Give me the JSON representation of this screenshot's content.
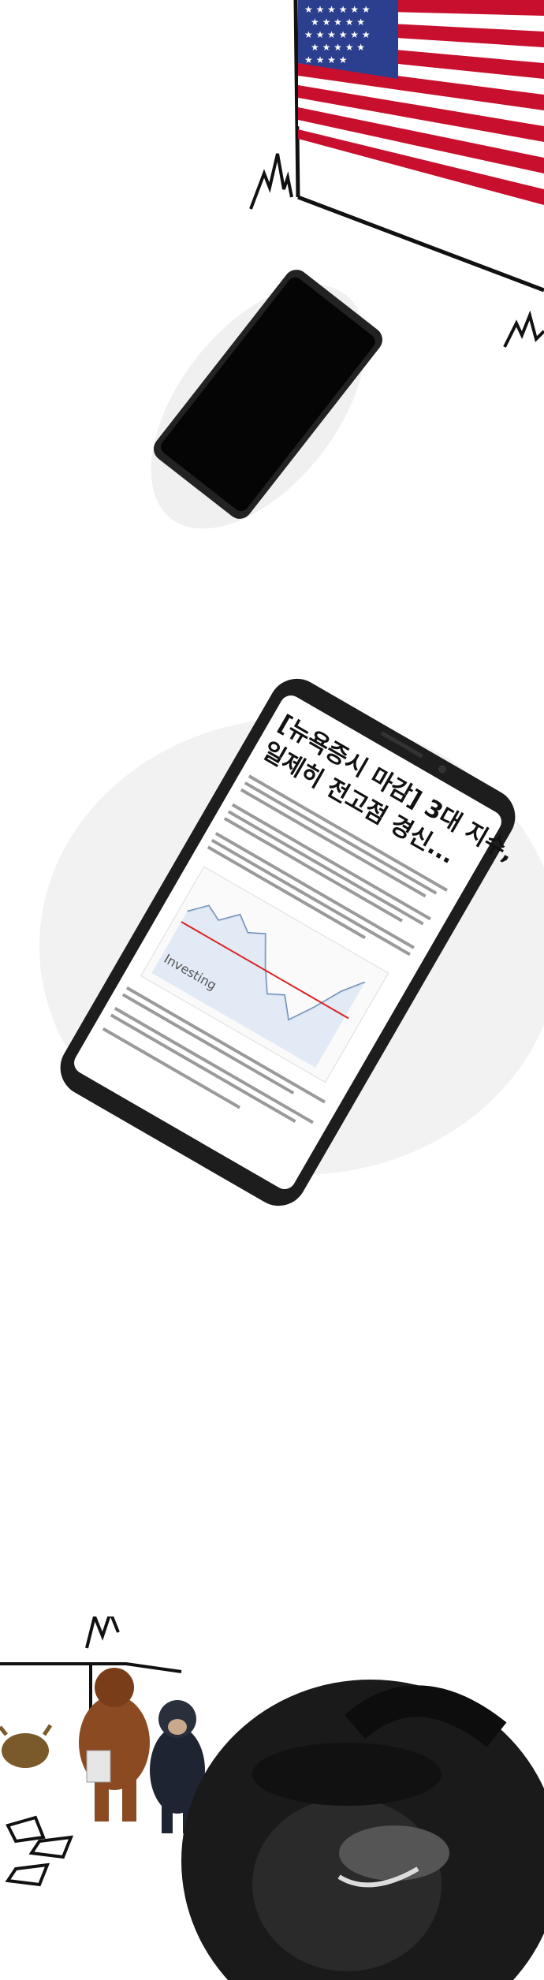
{
  "comic": {
    "panel_1": {
      "flag_icon": "us-flag-icon",
      "phone_screen": "off"
    },
    "panel_2": {
      "article": {
        "headline_line1": "[뉴욕증시 마감] 3대 지수,",
        "headline_line2": "일제히 전고점 경신...",
        "chart_brand": "Investing"
      }
    },
    "panel_3": {
      "characters": [
        "bull-statue-icon",
        "orangutan-icon",
        "chimpanzee-icon",
        "chimpanzee-closeup-icon"
      ]
    }
  }
}
